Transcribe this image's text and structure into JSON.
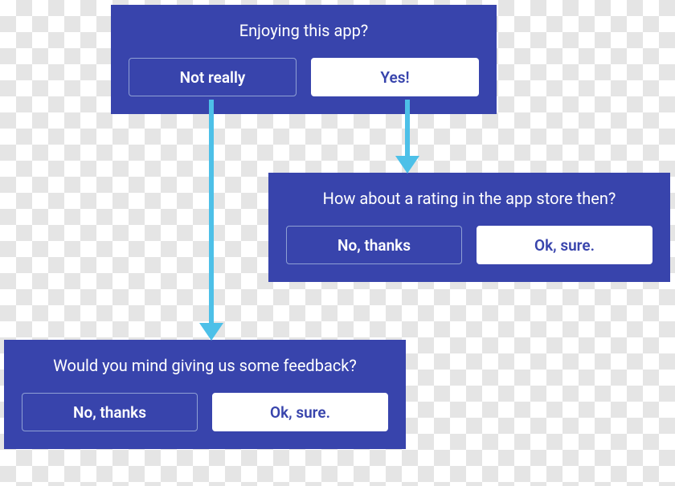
{
  "cards": {
    "enjoy": {
      "question": "Enjoying this app?",
      "left": "Not really",
      "right": "Yes!"
    },
    "rate": {
      "question": "How about a rating in the app store then?",
      "left": "No, thanks",
      "right": "Ok, sure."
    },
    "feedback": {
      "question": "Would you mind giving us some feedback?",
      "left": "No, thanks",
      "right": "Ok, sure."
    }
  },
  "colors": {
    "card_bg": "#3844AC",
    "arrow": "#4DC0E8"
  }
}
